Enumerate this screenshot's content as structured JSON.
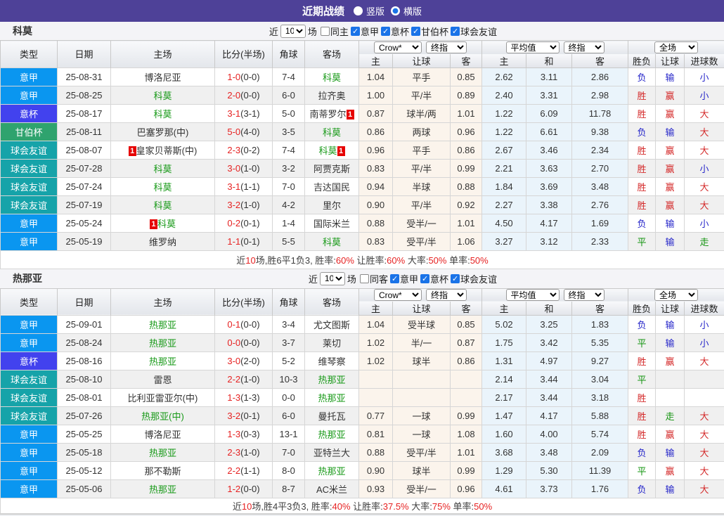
{
  "colors": {
    "topbar": "#4e4198",
    "type_yijia": "#0a96f0",
    "type_yibei": "#4242ee",
    "type_ganbobei": "#2fa36e",
    "type_qiuhui": "#16a3a9",
    "team_green": "#179917",
    "score_red": "#e62222",
    "res_red": "#d42a2a",
    "res_blue": "#2626c9",
    "res_green": "#13940f",
    "badge_red": "#e60000"
  },
  "topbar": {
    "title": "近期战绩",
    "radios": [
      {
        "label": "竖版",
        "selected": false
      },
      {
        "label": "横版",
        "selected": true
      }
    ]
  },
  "table_header": {
    "cols": [
      "类型",
      "日期",
      "主场",
      "比分(半场)",
      "角球",
      "客场"
    ],
    "crown_select": "Crow*",
    "final_select": "终指",
    "avg_select": "平均值",
    "final2_select": "终指",
    "full_select": "全场",
    "sub": [
      "主",
      "让球",
      "客",
      "主",
      "和",
      "客",
      "胜负",
      "让球",
      "进球数"
    ]
  },
  "filter_labels": {
    "near": "近",
    "count": "10",
    "games": "场"
  },
  "sections": [
    {
      "team": "科莫",
      "same_label": "同主",
      "same_checked": false,
      "leagues": [
        {
          "label": "意甲",
          "checked": true
        },
        {
          "label": "意杯",
          "checked": true
        },
        {
          "label": "甘伯杯",
          "checked": true
        },
        {
          "label": "球会友谊",
          "checked": true
        }
      ],
      "rows": [
        {
          "type": "意甲",
          "tc": "type_yijia",
          "date": "25-08-31",
          "home": {
            "text": "博洛尼亚",
            "green": false
          },
          "ft": "1-0",
          "ht": "(0-0)",
          "corner": "7-4",
          "away": {
            "text": "科莫",
            "green": true
          },
          "crown": [
            "1.04",
            "平手",
            "0.85"
          ],
          "avg": [
            "2.62",
            "3.11",
            "2.86"
          ],
          "res": [
            {
              "t": "负",
              "c": "res_blue"
            },
            {
              "t": "输",
              "c": "res_blue"
            },
            {
              "t": "小",
              "c": "res_blue"
            }
          ]
        },
        {
          "type": "意甲",
          "tc": "type_yijia",
          "date": "25-08-25",
          "home": {
            "text": "科莫",
            "green": true
          },
          "ft": "2-0",
          "ht": "(0-0)",
          "corner": "6-0",
          "away": {
            "text": "拉齐奥",
            "green": false
          },
          "crown": [
            "1.00",
            "平/半",
            "0.89"
          ],
          "avg": [
            "2.40",
            "3.31",
            "2.98"
          ],
          "res": [
            {
              "t": "胜",
              "c": "res_red"
            },
            {
              "t": "赢",
              "c": "res_red"
            },
            {
              "t": "小",
              "c": "res_blue"
            }
          ]
        },
        {
          "type": "意杯",
          "tc": "type_yibei",
          "date": "25-08-17",
          "home": {
            "text": "科莫",
            "green": true
          },
          "ft": "3-1",
          "ht": "(3-1)",
          "corner": "5-0",
          "away": {
            "text": "南蒂罗尔",
            "green": false,
            "badge": "1",
            "badge_pos": "after"
          },
          "crown": [
            "0.87",
            "球半/两",
            "1.01"
          ],
          "avg": [
            "1.22",
            "6.09",
            "11.78"
          ],
          "res": [
            {
              "t": "胜",
              "c": "res_red"
            },
            {
              "t": "赢",
              "c": "res_red"
            },
            {
              "t": "大",
              "c": "res_red"
            }
          ]
        },
        {
          "type": "甘伯杯",
          "tc": "type_ganbobei",
          "date": "25-08-11",
          "home": {
            "text": "巴塞罗那(中)",
            "green": false
          },
          "ft": "5-0",
          "ht": "(4-0)",
          "corner": "3-5",
          "away": {
            "text": "科莫",
            "green": true
          },
          "crown": [
            "0.86",
            "两球",
            "0.96"
          ],
          "avg": [
            "1.22",
            "6.61",
            "9.38"
          ],
          "res": [
            {
              "t": "负",
              "c": "res_blue"
            },
            {
              "t": "输",
              "c": "res_blue"
            },
            {
              "t": "大",
              "c": "res_red"
            }
          ]
        },
        {
          "type": "球会友谊",
          "tc": "type_qiuhui",
          "date": "25-08-07",
          "home": {
            "text": "皇家贝蒂斯(中)",
            "green": false,
            "badge": "1",
            "badge_pos": "before"
          },
          "ft": "2-3",
          "ht": "(0-2)",
          "corner": "7-4",
          "away": {
            "text": "科莫",
            "green": true,
            "badge": "1",
            "badge_pos": "after"
          },
          "crown": [
            "0.96",
            "平手",
            "0.86"
          ],
          "avg": [
            "2.67",
            "3.46",
            "2.34"
          ],
          "res": [
            {
              "t": "胜",
              "c": "res_red"
            },
            {
              "t": "赢",
              "c": "res_red"
            },
            {
              "t": "大",
              "c": "res_red"
            }
          ]
        },
        {
          "type": "球会友谊",
          "tc": "type_qiuhui",
          "date": "25-07-28",
          "home": {
            "text": "科莫",
            "green": true
          },
          "ft": "3-0",
          "ht": "(1-0)",
          "corner": "3-2",
          "away": {
            "text": "阿贾克斯",
            "green": false
          },
          "crown": [
            "0.83",
            "平/半",
            "0.99"
          ],
          "avg": [
            "2.21",
            "3.63",
            "2.70"
          ],
          "res": [
            {
              "t": "胜",
              "c": "res_red"
            },
            {
              "t": "赢",
              "c": "res_red"
            },
            {
              "t": "小",
              "c": "res_blue"
            }
          ]
        },
        {
          "type": "球会友谊",
          "tc": "type_qiuhui",
          "date": "25-07-24",
          "home": {
            "text": "科莫",
            "green": true
          },
          "ft": "3-1",
          "ht": "(1-1)",
          "corner": "7-0",
          "away": {
            "text": "吉达国民",
            "green": false
          },
          "crown": [
            "0.94",
            "半球",
            "0.88"
          ],
          "avg": [
            "1.84",
            "3.69",
            "3.48"
          ],
          "res": [
            {
              "t": "胜",
              "c": "res_red"
            },
            {
              "t": "赢",
              "c": "res_red"
            },
            {
              "t": "大",
              "c": "res_red"
            }
          ]
        },
        {
          "type": "球会友谊",
          "tc": "type_qiuhui",
          "date": "25-07-19",
          "home": {
            "text": "科莫",
            "green": true
          },
          "ft": "3-2",
          "ht": "(1-0)",
          "corner": "4-2",
          "away": {
            "text": "里尔",
            "green": false
          },
          "crown": [
            "0.90",
            "平/半",
            "0.92"
          ],
          "avg": [
            "2.27",
            "3.38",
            "2.76"
          ],
          "res": [
            {
              "t": "胜",
              "c": "res_red"
            },
            {
              "t": "赢",
              "c": "res_red"
            },
            {
              "t": "大",
              "c": "res_red"
            }
          ]
        },
        {
          "type": "意甲",
          "tc": "type_yijia",
          "date": "25-05-24",
          "home": {
            "text": "科莫",
            "green": true,
            "badge": "1",
            "badge_pos": "before"
          },
          "ft": "0-2",
          "ht": "(0-1)",
          "corner": "1-4",
          "away": {
            "text": "国际米兰",
            "green": false
          },
          "crown": [
            "0.88",
            "受半/一",
            "1.01"
          ],
          "avg": [
            "4.50",
            "4.17",
            "1.69"
          ],
          "res": [
            {
              "t": "负",
              "c": "res_blue"
            },
            {
              "t": "输",
              "c": "res_blue"
            },
            {
              "t": "小",
              "c": "res_blue"
            }
          ]
        },
        {
          "type": "意甲",
          "tc": "type_yijia",
          "date": "25-05-19",
          "home": {
            "text": "维罗纳",
            "green": false
          },
          "ft": "1-1",
          "ht": "(0-1)",
          "corner": "5-5",
          "away": {
            "text": "科莫",
            "green": true
          },
          "crown": [
            "0.83",
            "受平/半",
            "1.06"
          ],
          "avg": [
            "3.27",
            "3.12",
            "2.33"
          ],
          "res": [
            {
              "t": "平",
              "c": "res_green"
            },
            {
              "t": "输",
              "c": "res_blue"
            },
            {
              "t": "走",
              "c": "res_green"
            }
          ]
        }
      ],
      "summary": [
        {
          "text": "近",
          "red": false
        },
        {
          "text": "10",
          "red": true
        },
        {
          "text": "场,胜6平1负3, 胜率:",
          "red": false
        },
        {
          "text": "60%",
          "red": true
        },
        {
          "text": " 让胜率:",
          "red": false
        },
        {
          "text": "60%",
          "red": true
        },
        {
          "text": " 大率:",
          "red": false
        },
        {
          "text": "50%",
          "red": true
        },
        {
          "text": " 单率:",
          "red": false
        },
        {
          "text": "50%",
          "red": true
        }
      ]
    },
    {
      "team": "热那亚",
      "same_label": "同客",
      "same_checked": false,
      "leagues": [
        {
          "label": "意甲",
          "checked": true
        },
        {
          "label": "意杯",
          "checked": true
        },
        {
          "label": "球会友谊",
          "checked": true
        }
      ],
      "rows": [
        {
          "type": "意甲",
          "tc": "type_yijia",
          "date": "25-09-01",
          "home": {
            "text": "热那亚",
            "green": true
          },
          "ft": "0-1",
          "ht": "(0-0)",
          "corner": "3-4",
          "away": {
            "text": "尤文图斯",
            "green": false
          },
          "crown": [
            "1.04",
            "受半球",
            "0.85"
          ],
          "avg": [
            "5.02",
            "3.25",
            "1.83"
          ],
          "res": [
            {
              "t": "负",
              "c": "res_blue"
            },
            {
              "t": "输",
              "c": "res_blue"
            },
            {
              "t": "小",
              "c": "res_blue"
            }
          ]
        },
        {
          "type": "意甲",
          "tc": "type_yijia",
          "date": "25-08-24",
          "home": {
            "text": "热那亚",
            "green": true
          },
          "ft": "0-0",
          "ht": "(0-0)",
          "corner": "3-7",
          "away": {
            "text": "莱切",
            "green": false
          },
          "crown": [
            "1.02",
            "半/一",
            "0.87"
          ],
          "avg": [
            "1.75",
            "3.42",
            "5.35"
          ],
          "res": [
            {
              "t": "平",
              "c": "res_green"
            },
            {
              "t": "输",
              "c": "res_blue"
            },
            {
              "t": "小",
              "c": "res_blue"
            }
          ]
        },
        {
          "type": "意杯",
          "tc": "type_yibei",
          "date": "25-08-16",
          "home": {
            "text": "热那亚",
            "green": true
          },
          "ft": "3-0",
          "ht": "(2-0)",
          "corner": "5-2",
          "away": {
            "text": "维琴察",
            "green": false
          },
          "crown": [
            "1.02",
            "球半",
            "0.86"
          ],
          "avg": [
            "1.31",
            "4.97",
            "9.27"
          ],
          "res": [
            {
              "t": "胜",
              "c": "res_red"
            },
            {
              "t": "赢",
              "c": "res_red"
            },
            {
              "t": "大",
              "c": "res_red"
            }
          ]
        },
        {
          "type": "球会友谊",
          "tc": "type_qiuhui",
          "date": "25-08-10",
          "home": {
            "text": "雷恩",
            "green": false
          },
          "ft": "2-2",
          "ht": "(1-0)",
          "corner": "10-3",
          "away": {
            "text": "热那亚",
            "green": true
          },
          "crown": [
            "",
            "",
            ""
          ],
          "avg": [
            "2.14",
            "3.44",
            "3.04"
          ],
          "res": [
            {
              "t": "平",
              "c": "res_green"
            },
            {
              "t": "",
              "c": "res_blue"
            },
            {
              "t": "",
              "c": "res_blue"
            }
          ]
        },
        {
          "type": "球会友谊",
          "tc": "type_qiuhui",
          "date": "25-08-01",
          "home": {
            "text": "比利亚雷亚尔(中)",
            "green": false
          },
          "ft": "1-3",
          "ht": "(1-3)",
          "corner": "0-0",
          "away": {
            "text": "热那亚",
            "green": true
          },
          "crown": [
            "",
            "",
            ""
          ],
          "avg": [
            "2.17",
            "3.44",
            "3.18"
          ],
          "res": [
            {
              "t": "胜",
              "c": "res_red"
            },
            {
              "t": "",
              "c": "res_blue"
            },
            {
              "t": "",
              "c": "res_blue"
            }
          ]
        },
        {
          "type": "球会友谊",
          "tc": "type_qiuhui",
          "date": "25-07-26",
          "home": {
            "text": "热那亚(中)",
            "green": true
          },
          "ft": "3-2",
          "ht": "(0-1)",
          "corner": "6-0",
          "away": {
            "text": "曼托瓦",
            "green": false
          },
          "crown": [
            "0.77",
            "一球",
            "0.99"
          ],
          "avg": [
            "1.47",
            "4.17",
            "5.88"
          ],
          "res": [
            {
              "t": "胜",
              "c": "res_red"
            },
            {
              "t": "走",
              "c": "res_green"
            },
            {
              "t": "大",
              "c": "res_red"
            }
          ]
        },
        {
          "type": "意甲",
          "tc": "type_yijia",
          "date": "25-05-25",
          "home": {
            "text": "博洛尼亚",
            "green": false
          },
          "ft": "1-3",
          "ht": "(0-3)",
          "corner": "13-1",
          "away": {
            "text": "热那亚",
            "green": true
          },
          "crown": [
            "0.81",
            "一球",
            "1.08"
          ],
          "avg": [
            "1.60",
            "4.00",
            "5.74"
          ],
          "res": [
            {
              "t": "胜",
              "c": "res_red"
            },
            {
              "t": "赢",
              "c": "res_red"
            },
            {
              "t": "大",
              "c": "res_red"
            }
          ]
        },
        {
          "type": "意甲",
          "tc": "type_yijia",
          "date": "25-05-18",
          "home": {
            "text": "热那亚",
            "green": true
          },
          "ft": "2-3",
          "ht": "(1-0)",
          "corner": "7-0",
          "away": {
            "text": "亚特兰大",
            "green": false
          },
          "crown": [
            "0.88",
            "受平/半",
            "1.01"
          ],
          "avg": [
            "3.68",
            "3.48",
            "2.09"
          ],
          "res": [
            {
              "t": "负",
              "c": "res_blue"
            },
            {
              "t": "输",
              "c": "res_blue"
            },
            {
              "t": "大",
              "c": "res_red"
            }
          ]
        },
        {
          "type": "意甲",
          "tc": "type_yijia",
          "date": "25-05-12",
          "home": {
            "text": "那不勒斯",
            "green": false
          },
          "ft": "2-2",
          "ht": "(1-1)",
          "corner": "8-0",
          "away": {
            "text": "热那亚",
            "green": true
          },
          "crown": [
            "0.90",
            "球半",
            "0.99"
          ],
          "avg": [
            "1.29",
            "5.30",
            "11.39"
          ],
          "res": [
            {
              "t": "平",
              "c": "res_green"
            },
            {
              "t": "赢",
              "c": "res_red"
            },
            {
              "t": "大",
              "c": "res_red"
            }
          ]
        },
        {
          "type": "意甲",
          "tc": "type_yijia",
          "date": "25-05-06",
          "home": {
            "text": "热那亚",
            "green": true
          },
          "ft": "1-2",
          "ht": "(0-0)",
          "corner": "8-7",
          "away": {
            "text": "AC米兰",
            "green": false
          },
          "crown": [
            "0.93",
            "受半/一",
            "0.96"
          ],
          "avg": [
            "4.61",
            "3.73",
            "1.76"
          ],
          "res": [
            {
              "t": "负",
              "c": "res_blue"
            },
            {
              "t": "输",
              "c": "res_blue"
            },
            {
              "t": "大",
              "c": "res_red"
            }
          ]
        }
      ],
      "summary": [
        {
          "text": "近",
          "red": false
        },
        {
          "text": "10",
          "red": true
        },
        {
          "text": "场,胜4平3负3, 胜率:",
          "red": false
        },
        {
          "text": "40%",
          "red": true
        },
        {
          "text": " 让胜率:",
          "red": false
        },
        {
          "text": "37.5%",
          "red": true
        },
        {
          "text": " 大率:",
          "red": false
        },
        {
          "text": "75%",
          "red": true
        },
        {
          "text": " 单率:",
          "red": false
        },
        {
          "text": "50%",
          "red": true
        }
      ]
    }
  ]
}
